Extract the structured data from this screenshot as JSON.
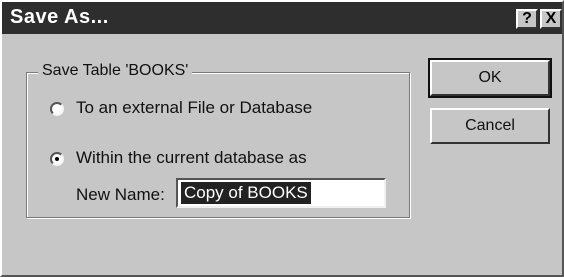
{
  "window": {
    "title": "Save As..."
  },
  "titlebar_buttons": {
    "help": "?",
    "close": "X"
  },
  "group": {
    "label": "Save Table 'BOOKS'",
    "option_external": "To an external File or Database",
    "option_current": "Within the current database as",
    "selected": "current"
  },
  "new_name": {
    "label": "New Name:",
    "value": "Copy of BOOKS"
  },
  "buttons": {
    "ok": "OK",
    "cancel": "Cancel"
  }
}
